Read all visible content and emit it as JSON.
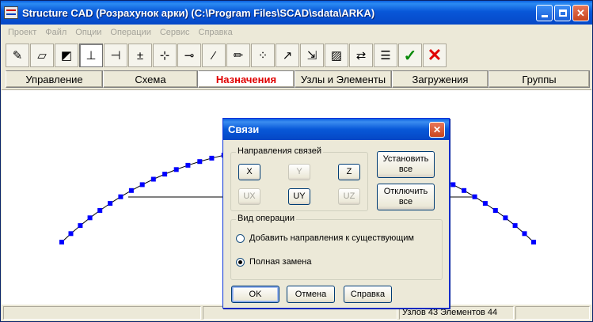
{
  "window": {
    "title": "Structure CAD (Розрахунок арки) (C:\\Program Files\\SCAD\\sdata\\ARKA)"
  },
  "menu": [
    "Проект",
    "Файл",
    "Опции",
    "Операции",
    "Сервис",
    "Справка"
  ],
  "toolbar": {
    "tools": [
      {
        "name": "pencil-tool-icon",
        "glyph": "✎"
      },
      {
        "name": "stiffness-tool-icon",
        "glyph": "▱"
      },
      {
        "name": "section-tool-icon",
        "glyph": "◩"
      },
      {
        "name": "support-tool-icon",
        "glyph": "⊥",
        "pressed": true
      },
      {
        "name": "joint-tool-icon",
        "glyph": "⊣"
      },
      {
        "name": "insert-node-icon",
        "glyph": "±"
      },
      {
        "name": "hinge-icon",
        "glyph": "⊹"
      },
      {
        "name": "release-icon",
        "glyph": "⊸"
      },
      {
        "name": "magic-wand-icon",
        "glyph": "⁄"
      },
      {
        "name": "edit-pencil-icon",
        "glyph": "✏"
      },
      {
        "name": "nodes-grid-icon",
        "glyph": "⁘"
      },
      {
        "name": "local-axes-icon",
        "glyph": "↗"
      },
      {
        "name": "coordinate-icon",
        "glyph": "⇲"
      },
      {
        "name": "color-fill-icon",
        "glyph": "▨"
      },
      {
        "name": "rigid-insert-icon",
        "glyph": "⇄"
      },
      {
        "name": "list-icon",
        "glyph": "☰"
      },
      {
        "name": "apply-check-icon",
        "glyph": "✓",
        "kind": "check"
      },
      {
        "name": "cancel-x-icon",
        "glyph": "✕",
        "kind": "cancel"
      }
    ]
  },
  "tabs": [
    {
      "label": "Управление",
      "active": false
    },
    {
      "label": "Схема",
      "active": false
    },
    {
      "label": "Назначения",
      "active": true
    },
    {
      "label": "Узлы и Элементы",
      "active": false
    },
    {
      "label": "Загружения",
      "active": false
    },
    {
      "label": "Группы",
      "active": false
    }
  ],
  "status": {
    "cells": [
      "",
      "",
      "Узлов 43 Элементов 44",
      ""
    ]
  },
  "dialog": {
    "title": "Связи",
    "directions_group": "Направления связей",
    "directions": [
      {
        "label": "X",
        "enabled": true
      },
      {
        "label": "Y",
        "enabled": false
      },
      {
        "label": "Z",
        "enabled": true
      },
      {
        "label": "UX",
        "enabled": false
      },
      {
        "label": "UY",
        "enabled": true
      },
      {
        "label": "UZ",
        "enabled": false
      }
    ],
    "set_all_label": "Установить все",
    "clear_all_label": "Отключить все",
    "operation_group": "Вид операции",
    "options": [
      {
        "label": "Добавить направления к существующим",
        "checked": false
      },
      {
        "label": "Полная замена",
        "checked": true
      }
    ],
    "ok_label": "OK",
    "cancel_label": "Отмена",
    "help_label": "Справка"
  },
  "colors": {
    "node_fill": "#0000ff",
    "active_tab_text": "#e00000"
  }
}
